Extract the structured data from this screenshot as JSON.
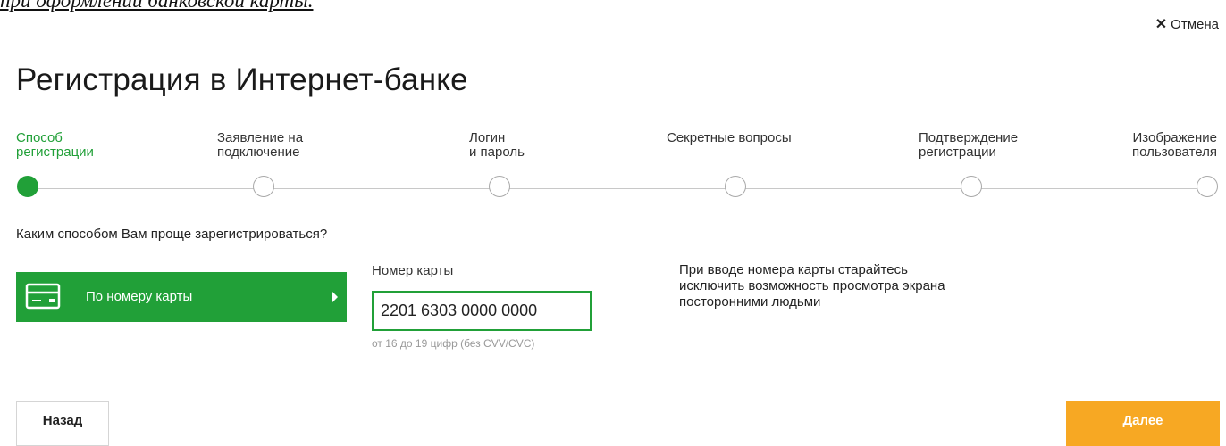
{
  "caption": "при оформлении банковской карты.",
  "header": {
    "cancel_label": "Отмена",
    "cancel_icon": "close-icon"
  },
  "title": "Регистрация в Интернет-банке",
  "steps": [
    {
      "line1": "Способ",
      "line2": "регистрации",
      "active": true
    },
    {
      "line1": "Заявление на",
      "line2": "подключение",
      "active": false
    },
    {
      "line1": "Логин",
      "line2": "и пароль",
      "active": false
    },
    {
      "line1": "Секретные вопросы",
      "line2": "",
      "active": false
    },
    {
      "line1": "Подтверждение",
      "line2": "регистрации",
      "active": false
    },
    {
      "line1": "Изображение",
      "line2": "пользователя",
      "active": false
    }
  ],
  "question": "Каким способом Вам проще зарегистрироваться?",
  "method": {
    "label": "По номеру карты",
    "icon": "credit-card-icon"
  },
  "card_field": {
    "label": "Номер карты",
    "value": "2201 6303 0000 0000",
    "hint": "от 16 до 19 цифр (без CVV/CVC)"
  },
  "note": "При вводе номера карты старайтесь исключить возможность просмотра экрана посторонними людьми",
  "footer": {
    "back_label": "Назад",
    "next_label": "Далее"
  },
  "colors": {
    "accent": "#21a038",
    "next_button": "#f7a823"
  }
}
